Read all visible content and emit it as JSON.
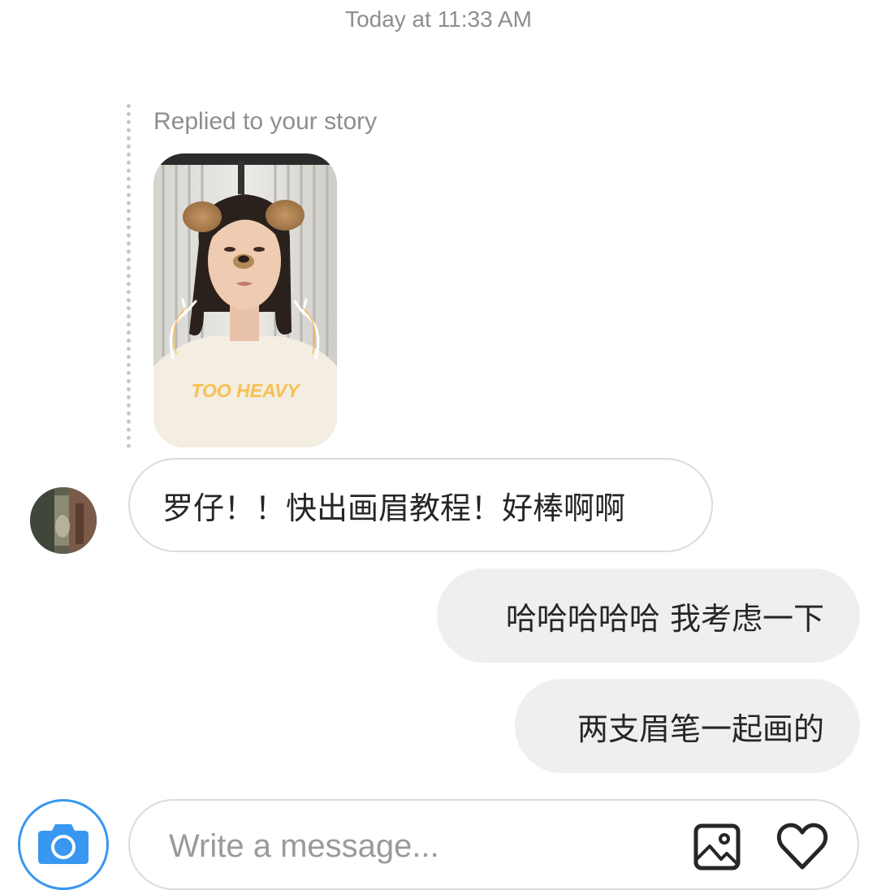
{
  "thread": {
    "timestamp": "Today at 11:33 AM"
  },
  "story_reply": {
    "label": "Replied to your story",
    "thumbnail_text": "TOO HEAVY"
  },
  "messages": [
    {
      "direction": "incoming",
      "text": "罗仔！！快出画眉教程！好棒啊啊"
    },
    {
      "direction": "outgoing",
      "text": "哈哈哈哈哈 我考虑一下"
    },
    {
      "direction": "outgoing",
      "text": "两支眉笔一起画的"
    }
  ],
  "composer": {
    "placeholder": "Write a message..."
  },
  "icons": {
    "camera": "camera-icon",
    "gallery": "gallery-icon",
    "like": "heart-icon"
  },
  "colors": {
    "accent": "#3897f0",
    "incoming_border": "#dbdbdb",
    "outgoing_bubble": "#efefef",
    "secondary_text": "#8e8e8e",
    "sticker_text": "#f6c152"
  }
}
